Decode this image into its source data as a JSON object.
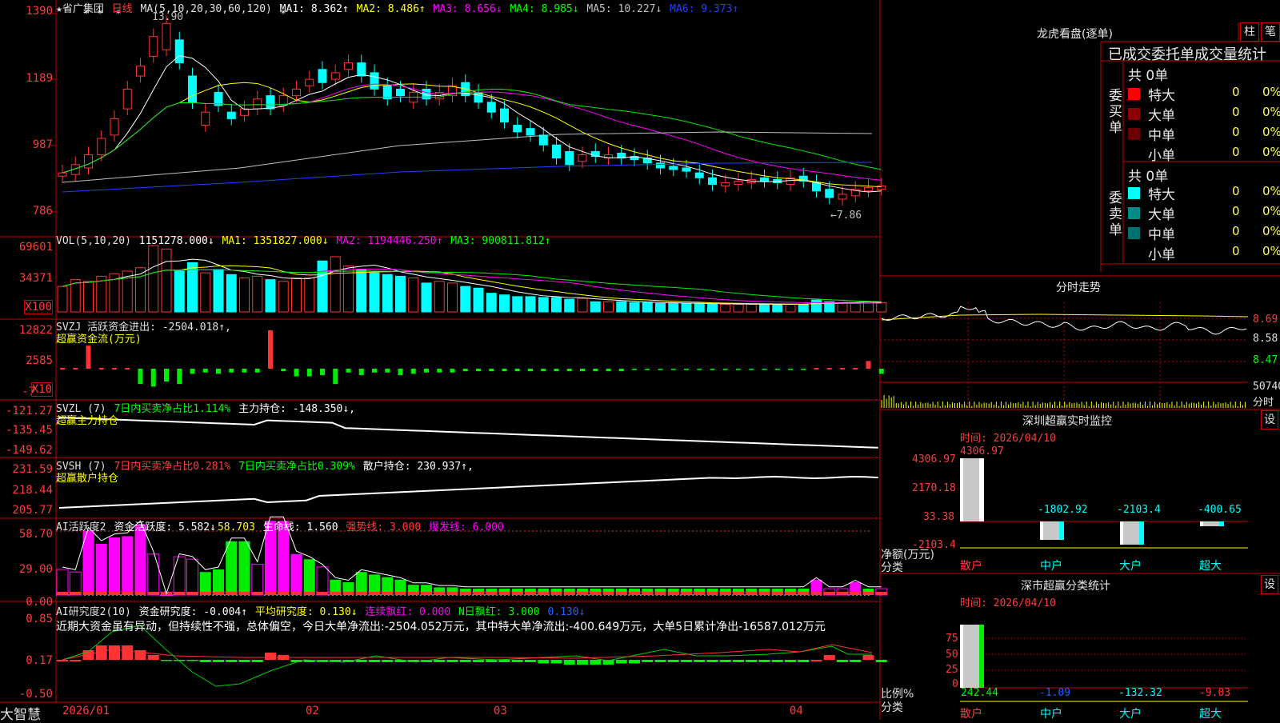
{
  "stock": {
    "name": "★省广集团",
    "period": "日线"
  },
  "ma_header": {
    "params": "MA(5,10,20,30,60,120)",
    "ma1": "MA1: 8.362↑",
    "ma2": "MA2: 8.486↑",
    "ma3": "MA3: 8.656↓",
    "ma4": "MA4: 8.985↓",
    "ma5": "MA5: 10.227↓",
    "ma6": "MA6: 9.373↑"
  },
  "price_axis": [
    "1390",
    "1189",
    "987",
    "786"
  ],
  "price_marks": {
    "high": "13.90",
    "low": "←7.86"
  },
  "vol_header": {
    "params": "VOL(5,10,20)",
    "vol": "1151278.000↓",
    "ma1": "MA1: 1351827.000↓",
    "ma2": "MA2: 1194446.250↑",
    "ma3": "MA3: 900811.812↑"
  },
  "vol_axis": [
    "69601",
    "34371",
    "X100"
  ],
  "svzj": {
    "title": "SVZJ  活跃资金进出: -2504.018↑,",
    "subtitle": "超赢资金流(万元)",
    "axis": [
      "12822",
      "2585",
      "-7",
      "X10"
    ]
  },
  "svzl": {
    "title": "SVZL (7)",
    "ratio": "7日内买卖净占比1.114%",
    "hold": "主力持仓: -148.350↓,",
    "subtitle": "超赢主力持仓",
    "axis": [
      "-121.27",
      "-135.45",
      "-149.62"
    ]
  },
  "svsh": {
    "title": "SVSH (7)",
    "ratio1": "7日内买卖净占比0.281%",
    "ratio2": "7日内买卖净占比0.309%",
    "hold": "散户持仓: 230.937↑,",
    "subtitle": "超赢散户持仓",
    "axis": [
      "231.59",
      "218.44",
      "205.77"
    ]
  },
  "ai1": {
    "title": "AI活跃度2",
    "activity": "资金活跃度: 5.582↓",
    "v2": "58.703",
    "life": "生命线: 1.560",
    "strong": "强势线: 3.000",
    "burst": "爆发线: 6.000",
    "axis": [
      "58.70",
      "29.00",
      "0.00"
    ]
  },
  "ai2": {
    "title": "AI研究度2(10)",
    "research": "资金研究度: -0.004↑",
    "avg": "平均研究度: 0.130↓",
    "red": "连续飘红: 0.000",
    "nred": "N日飘红: 3.000",
    "last": "0.130↓",
    "comment": "近期大资金虽有异动，但持续性不强，总体偏空，今日大单净流出:-2504.052万元，其中特大单净流出:-400.649万元，大单5日累计净出-16587.012万元",
    "axis": [
      "0.85",
      "0.17",
      "-0.50"
    ]
  },
  "x_axis": [
    "2026/01",
    "02",
    "03",
    "04"
  ],
  "brand": "大智慧",
  "right": {
    "lhb_title": "龙虎看盘(逐单)",
    "btn_zhu": "柱",
    "btn_bi": "笔",
    "order_title": "已成交委托单成交量统计",
    "buy_label": "委买单",
    "sell_label": "委卖单",
    "buy_total": "共 0单",
    "sell_total": "共 0单",
    "buy_rows": [
      {
        "name": "特大",
        "v": "0",
        "p": "0%",
        "color": "#ff0000"
      },
      {
        "name": "大单",
        "v": "0",
        "p": "0%",
        "color": "#8b0000"
      },
      {
        "name": "中单",
        "v": "0",
        "p": "0%",
        "color": "#6a0000"
      },
      {
        "name": "小单",
        "v": "0",
        "p": "0%",
        "color": ""
      }
    ],
    "sell_rows": [
      {
        "name": "特大",
        "v": "0",
        "p": "0%",
        "color": "#00ffff"
      },
      {
        "name": "大单",
        "v": "0",
        "p": "0%",
        "color": "#008b8b"
      },
      {
        "name": "中单",
        "v": "0",
        "p": "0%",
        "color": "#007070"
      },
      {
        "name": "小单",
        "v": "0",
        "p": "0%",
        "color": ""
      }
    ],
    "intraday_title": "分时走势",
    "intraday_axis": [
      "8.69",
      "8.58",
      "8.47",
      "50740",
      "分时"
    ],
    "monitor_title": "深圳超赢实时监控",
    "monitor_time": "时间: 2026/04/10",
    "monitor_axis": [
      "4306.97",
      "2170.18",
      "33.38",
      "-2103.4"
    ],
    "monitor_ylabel": "净额(万元)",
    "monitor_xlabel": "分类",
    "monitor_values": [
      "4306.97",
      "-1802.92",
      "-2103.4",
      "-400.65"
    ],
    "categories": [
      "散户",
      "中户",
      "大户",
      "超大"
    ],
    "class_title": "深市超赢分类统计",
    "class_time": "时间: 2026/04/10",
    "class_axis": [
      "75",
      "50",
      "25",
      "0"
    ],
    "class_ylabel": "比例%",
    "class_xlabel": "分类",
    "class_values": [
      "242.44",
      "-1.09",
      "-132.32",
      "-9.03"
    ],
    "set_label": "设"
  }
}
